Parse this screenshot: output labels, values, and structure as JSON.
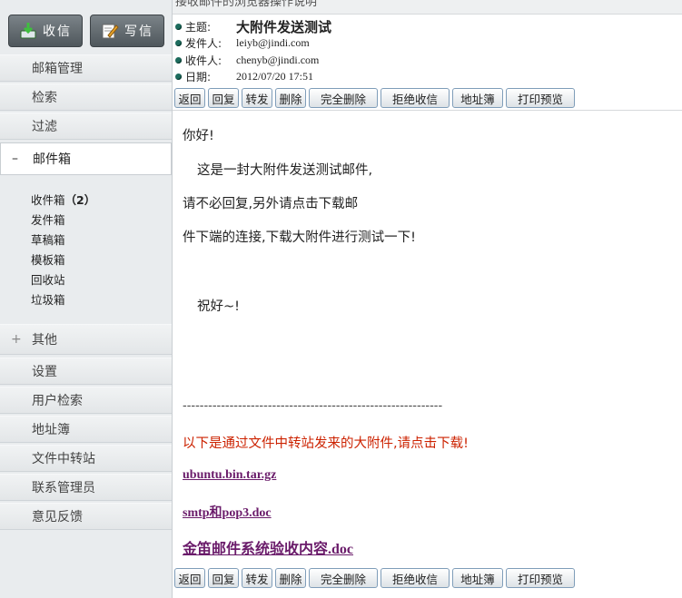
{
  "sidebar": {
    "receive_label": "收信",
    "write_label": "写信",
    "receive_icon": "inbox-download-icon",
    "write_icon": "compose-note-icon",
    "nav_top": [
      "邮箱管理",
      "检索",
      "过滤"
    ],
    "mailbox": {
      "sign": "–",
      "label": "邮件箱"
    },
    "folders": [
      {
        "name": "收件箱",
        "count": "（2）"
      },
      {
        "name": "发件箱"
      },
      {
        "name": "草稿箱"
      },
      {
        "name": "模板箱"
      },
      {
        "name": "回收站"
      },
      {
        "name": "垃圾箱"
      }
    ],
    "other": {
      "sign": "+",
      "label": "其他"
    },
    "nav_bottom": [
      "设置",
      "用户检索",
      "地址簿",
      "文件中转站",
      "联系管理员",
      "意见反馈"
    ]
  },
  "header": {
    "cut_text": "接收邮件的浏览器操作说明",
    "subject_label": "主题:",
    "subject": "大附件发送测试",
    "from_label": "发件人:",
    "from": "leiyb@jindi.com",
    "to_label": "收件人:",
    "to": "chenyb@jindi.com",
    "date_label": "日期:",
    "date": "2012/07/20 17:51"
  },
  "actions": [
    "返回",
    "回复",
    "转发",
    "删除",
    "完全删除",
    "拒绝收信",
    "地址簿",
    "打印预览"
  ],
  "body": {
    "greeting": "你好!",
    "line1": "这是一封大附件发送测试邮件,",
    "line2": "请不必回复,另外请点击下载邮",
    "line3": "件下端的连接,下载大附件进行测试一下!",
    "closing": "祝好~!",
    "separator": "-------------------------------------------------------------",
    "notice": "以下是通过文件中转站发来的大附件,请点击下载!",
    "attachments": [
      "ubuntu.bin.tar.gz",
      "smtp和pop3.doc",
      "金笛邮件系统验收内容.doc"
    ]
  },
  "colors": {
    "accent_dot": "#1d6b5d",
    "notice": "#cc2200",
    "link": "#6a1b6a",
    "button_border": "#7f9db9"
  }
}
